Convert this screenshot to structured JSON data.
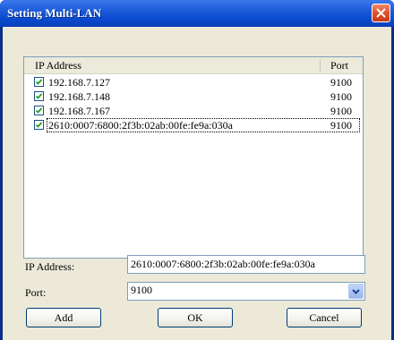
{
  "window": {
    "title": "Setting Multi-LAN"
  },
  "list": {
    "headers": {
      "ip": "IP Address",
      "port": "Port"
    },
    "rows": [
      {
        "ip": "192.168.7.127",
        "port": "9100",
        "checked": true
      },
      {
        "ip": "192.168.7.148",
        "port": "9100",
        "checked": true
      },
      {
        "ip": "192.168.7.167",
        "port": "9100",
        "checked": true
      },
      {
        "ip": "2610:0007:6800:2f3b:02ab:00fe:fe9a:030a",
        "port": "9100",
        "checked": true
      }
    ]
  },
  "form": {
    "ip_label": "IP Address:",
    "ip_value": "2610:0007:6800:2f3b:02ab:00fe:fe9a:030a",
    "port_label": "Port:",
    "port_value": "9100"
  },
  "buttons": {
    "add": "Add",
    "ok": "OK",
    "cancel": "Cancel"
  },
  "icons": {
    "close": "close-icon",
    "check": "checkmark-icon",
    "dropdown": "chevron-down-icon"
  },
  "colors": {
    "titlebar": "#0a4ad0",
    "close": "#e0502a",
    "check": "#21a121"
  }
}
